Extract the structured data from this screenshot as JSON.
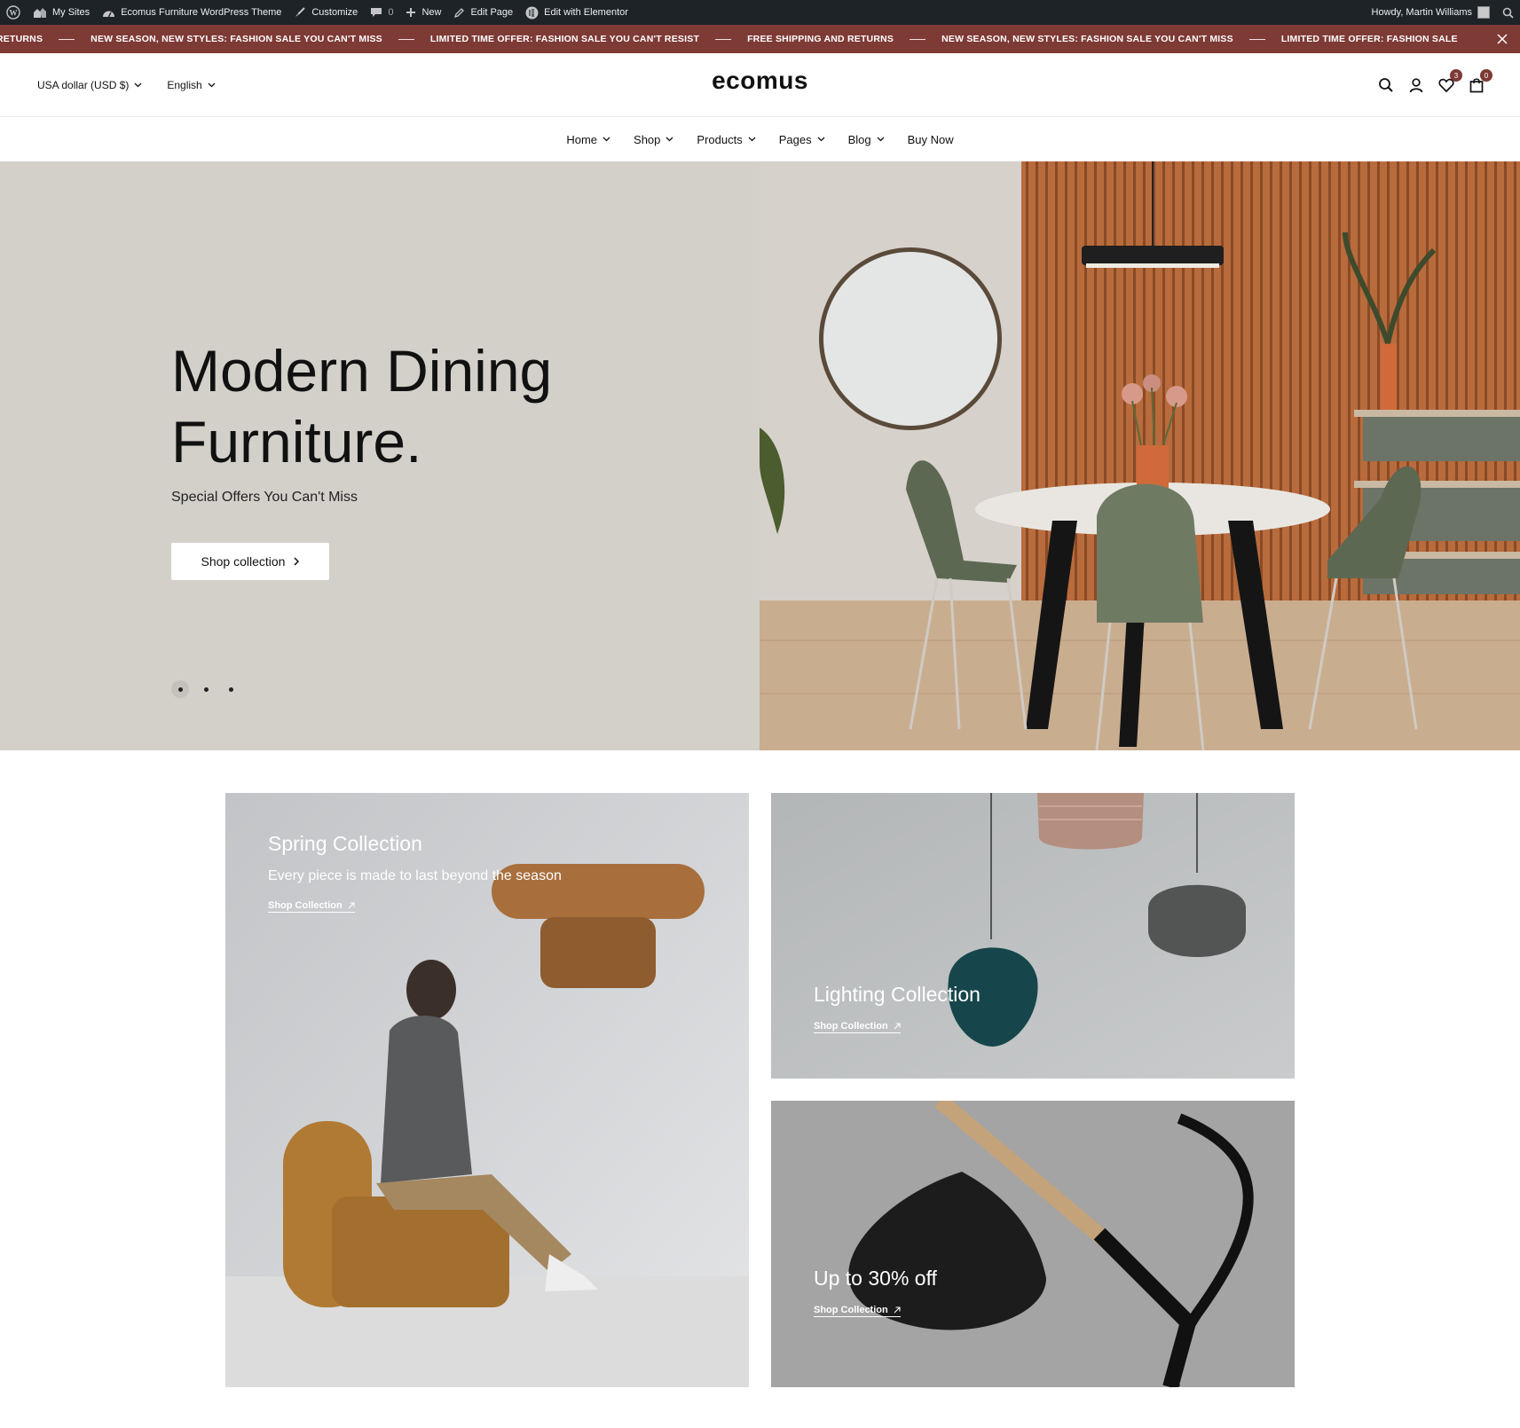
{
  "admin_bar": {
    "my_sites": "My Sites",
    "site_name": "Ecomus Furniture WordPress Theme",
    "customize": "Customize",
    "comments_count": "0",
    "new": "New",
    "edit_page": "Edit Page",
    "edit_elementor": "Edit with Elementor",
    "howdy": "Howdy, Martin Williams"
  },
  "announcement": {
    "items": [
      "RETURNS",
      "NEW SEASON, NEW STYLES: FASHION SALE YOU CAN'T MISS",
      "LIMITED TIME OFFER: FASHION SALE YOU CAN'T RESIST",
      "FREE SHIPPING AND RETURNS",
      "NEW SEASON, NEW STYLES: FASHION SALE YOU CAN'T MISS",
      "LIMITED TIME OFFER: FASHION SALE"
    ]
  },
  "header": {
    "currency": "USA dollar (USD $)",
    "language": "English",
    "logo": "ecomus",
    "wishlist_count": "3",
    "cart_count": "0"
  },
  "nav": {
    "items": [
      {
        "label": "Home"
      },
      {
        "label": "Shop"
      },
      {
        "label": "Products"
      },
      {
        "label": "Pages"
      },
      {
        "label": "Blog"
      },
      {
        "label": "Buy Now"
      }
    ]
  },
  "hero": {
    "title": "Modern Dining Furniture.",
    "subtitle": "Special Offers You Can't Miss",
    "button": "Shop collection",
    "slide_count": 3,
    "active_slide": 1
  },
  "collections": [
    {
      "title": "Spring Collection",
      "description": "Every piece is made to last beyond the season",
      "link": "Shop Collection"
    },
    {
      "title": "Lighting Collection",
      "link": "Shop Collection"
    },
    {
      "title": "Up to 30% off",
      "link": "Shop Collection"
    }
  ],
  "colors": {
    "announcement_bg": "#7e3a35",
    "hero_bg": "#d3d0ca",
    "admin_bar_bg": "#1d2327"
  }
}
